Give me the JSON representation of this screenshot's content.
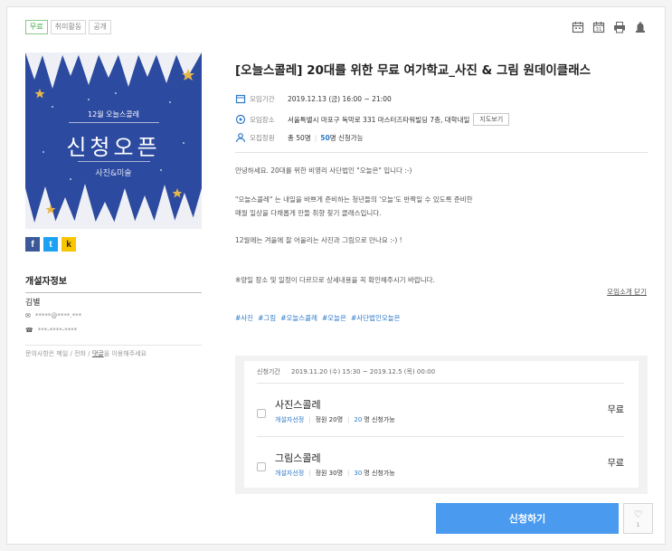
{
  "tags": [
    "무료",
    "취미활동",
    "공개"
  ],
  "toolbar_icons": [
    "calendar-icon",
    "calendar-31-icon",
    "print-icon",
    "alarm-icon"
  ],
  "poster": {
    "subtitle": "12월 오늘스콜레",
    "title": "신청오픈",
    "category": "사진&미술"
  },
  "share": [
    "f",
    "t",
    "k"
  ],
  "host": {
    "section_title": "개설자정보",
    "name": "김별",
    "email": "*****@****.***",
    "phone": "***-****-****",
    "note_prefix": "문의사항은 메일 / 전화 /",
    "note_link": "댓글",
    "note_suffix": "을 이용해주세요"
  },
  "event": {
    "title": "[오늘스콜레] 20대를 위한 무료 여가학교_사진 & 그림 원데이클래스",
    "period_label": "모임기간",
    "period_value": "2019.12.13 (금) 16:00 ~ 21:00",
    "place_label": "모임장소",
    "place_value": "서울특별시 마포구 독막로 331 마스터즈타워빌딩 7층, 대학내일",
    "map_button": "지도보기",
    "capacity_label": "모집정원",
    "capacity_total": "총 50명",
    "capacity_avail_num": "50",
    "capacity_avail_suffix": "명 신청가능"
  },
  "body": {
    "p1": "안녕하세요. 20대를 위한 비영리 사단법인 \"오늘은\" 입니다 :-)",
    "p2a": "\"오늘스콜레\" 는 내일을 바쁘게 준비하는 청년들의 '오늘'도 반짝일 수 있도록 준비한",
    "p2b": "매월 일상을 다채롭게 만들 취향 찾기 클래스입니다.",
    "p3": "12월에는 겨울에 잘 어울리는 사진과 그림으로 만나요 :-) !",
    "p4": "※양일 장소 및 일정이 다르므로 상세내용을 꼭 확인해주시기 바랍니다."
  },
  "close_link": "모임소개 닫기",
  "hashtags": [
    "#사진",
    "#그림",
    "#오늘스콜레",
    "#오늘은",
    "#사단법인오늘은"
  ],
  "apply": {
    "period_label": "신청기간",
    "period_value": "2019.11.20 (수) 15:30 ~ 2019.12.5 (목) 00:00",
    "courses": [
      {
        "name": "사진스콜레",
        "pick": "개설자선정",
        "quota": "정원 20명",
        "avail_num": "20",
        "avail_suffix": "명 신청가능",
        "price": "무료"
      },
      {
        "name": "그림스콜레",
        "pick": "개설자선정",
        "quota": "정원 30명",
        "avail_num": "30",
        "avail_suffix": "명 신청가능",
        "price": "무료"
      }
    ],
    "button": "신청하기",
    "like_count": "1"
  },
  "colors": {
    "accent": "#4a9bef",
    "link": "#2d78c8",
    "poster_bg": "#2c4a9f",
    "free_tag": "#3aa53a"
  }
}
